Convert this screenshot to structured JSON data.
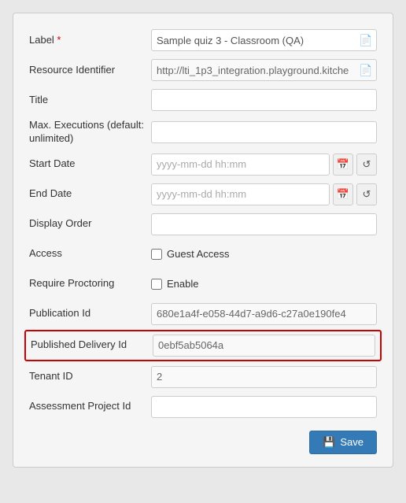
{
  "form": {
    "fields": {
      "label": {
        "label": "Label",
        "required": true,
        "value": "Sample quiz 3 - Classroom (QA)",
        "placeholder": ""
      },
      "resource_identifier": {
        "label": "Resource Identifier",
        "value": "http://lti_1p3_integration.playground.kitche",
        "placeholder": ""
      },
      "title": {
        "label": "Title",
        "value": "",
        "placeholder": ""
      },
      "max_executions": {
        "label": "Max. Executions (default: unlimited)",
        "value": "",
        "placeholder": ""
      },
      "start_date": {
        "label": "Start Date",
        "value": "",
        "placeholder": "yyyy-mm-dd hh:mm"
      },
      "end_date": {
        "label": "End Date",
        "value": "",
        "placeholder": "yyyy-mm-dd hh:mm"
      },
      "display_order": {
        "label": "Display Order",
        "value": "",
        "placeholder": ""
      },
      "access": {
        "label": "Access",
        "checkbox_label": "Guest Access",
        "checked": false
      },
      "require_proctoring": {
        "label": "Require Proctoring",
        "checkbox_label": "Enable",
        "checked": false
      },
      "publication_id": {
        "label": "Publication Id",
        "value": "680e1a4f-e058-44d7-a9d6-c27a0e190fe4"
      },
      "published_delivery_id": {
        "label": "Published Delivery Id",
        "value": "0ebf5ab5064a",
        "highlighted": true
      },
      "tenant_id": {
        "label": "Tenant ID",
        "value": "2"
      },
      "assessment_project_id": {
        "label": "Assessment Project Id",
        "value": "",
        "placeholder": ""
      }
    },
    "buttons": {
      "save": "Save"
    }
  }
}
